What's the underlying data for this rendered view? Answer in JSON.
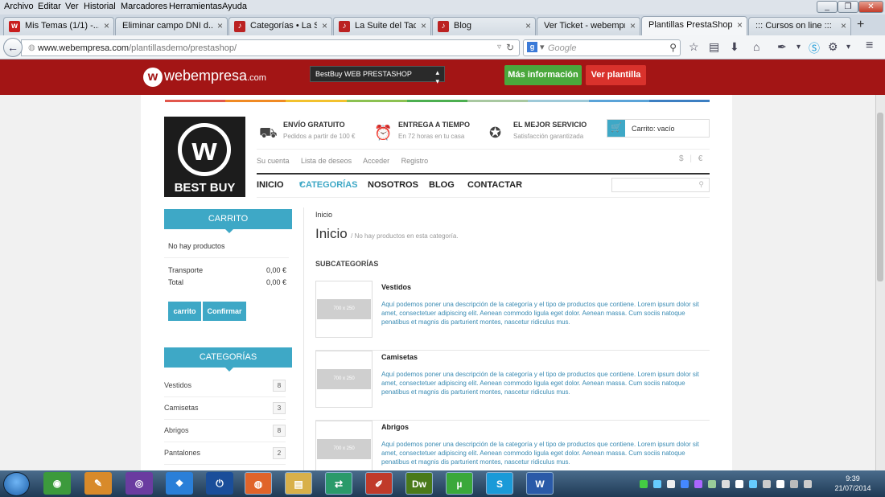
{
  "menu": [
    "Archivo",
    "Editar",
    "Ver",
    "Historial",
    "Marcadores",
    "Herramientas",
    "Ayuda"
  ],
  "tabs": [
    {
      "title": "Mis Temas (1/1) -...",
      "color": "#c81e1e",
      "glyph": "w"
    },
    {
      "title": "Eliminar campo DNI d...",
      "color": "",
      "glyph": ""
    },
    {
      "title": "Categorías • La Su...",
      "color": "#b22",
      "glyph": "♪"
    },
    {
      "title": "La Suite del Tacón",
      "color": "#b22",
      "glyph": "♪"
    },
    {
      "title": "Blog",
      "color": "#b22",
      "glyph": "♪"
    },
    {
      "title": "Ver Ticket - webempr...",
      "color": "",
      "glyph": ""
    },
    {
      "title": "Plantillas PrestaShop -...",
      "color": "",
      "glyph": ""
    },
    {
      "title": "::: Cursos on line :::",
      "color": "",
      "glyph": ""
    }
  ],
  "url": {
    "host": "www.webempresa.com",
    "path": "/plantillasdemo/prestashop/"
  },
  "search_placeholder": "Google",
  "demobar": {
    "logo_main": "webempresa",
    "logo_suffix": ".com",
    "theme_selected": "BestBuy WEB PRESTASHOP",
    "btn_info": "Más información",
    "btn_ver": "Ver plantilla"
  },
  "colors": {
    "accent": "#3ea8c6",
    "brand_red": "#a31515",
    "green": "#4aa83c"
  },
  "strip_colors": [
    "#e2574c",
    "#f08a24",
    "#f2c12e",
    "#8cc152",
    "#4caf50",
    "#a8c8a0",
    "#9ec9d8",
    "#5aa3d8",
    "#3c7fc2"
  ],
  "shop": {
    "logo_text": "BEST BUY",
    "features": [
      {
        "title": "ENVÍO GRATUITO",
        "sub": "Pedidos a partir de 100 €",
        "icon": "truck-icon"
      },
      {
        "title": "ENTREGA A TIEMPO",
        "sub": "En 72 horas en tu casa",
        "icon": "alarm-clock-icon"
      },
      {
        "title": "EL MEJOR SERVICIO",
        "sub": "Satisfacción garantizada",
        "icon": "medal-icon"
      }
    ],
    "cart_label": "Carrito: vacío",
    "toplinks": [
      "Su cuenta",
      "Lista de deseos",
      "Acceder",
      "Registro"
    ],
    "currencies": [
      "$",
      "€"
    ],
    "nav": [
      "INICIO",
      "CATEGORÍAS",
      "NOSOTROS",
      "BLOG",
      "CONTACTAR"
    ]
  },
  "cart": {
    "heading": "CARRITO",
    "empty": "No hay productos",
    "shipping_label": "Transporte",
    "shipping_value": "0,00 €",
    "total_label": "Total",
    "total_value": "0,00 €",
    "btn_cart": "carrito",
    "btn_confirm": "Confirmar"
  },
  "categories": {
    "heading": "CATEGORÍAS",
    "items": [
      {
        "name": "Vestidos",
        "count": "8"
      },
      {
        "name": "Camisetas",
        "count": "3"
      },
      {
        "name": "Abrigos",
        "count": "8"
      },
      {
        "name": "Pantalones",
        "count": "2"
      }
    ]
  },
  "main": {
    "breadcrumb": "Inicio",
    "title": "Inicio",
    "subtitle": "/ No hay productos en esta categoría.",
    "subcats_heading": "SUBCATEGORÍAS",
    "placeholder": "700 x 250",
    "subcats": [
      {
        "name": "Vestidos",
        "desc": "Aquí podemos poner una descripción de la categoría y el tipo de productos que contiene. Lorem ipsum dolor sit amet, consectetuer adipiscing elit. Aenean commodo ligula eget dolor. Aenean massa. Cum sociis natoque penatibus et magnis dis parturient montes, nascetur ridiculus mus."
      },
      {
        "name": "Camisetas",
        "desc": "Aquí podemos poner una descripción de la categoría y el tipo de productos que contiene. Lorem ipsum dolor sit amet, consectetuer adipiscing elit. Aenean commodo ligula eget dolor. Aenean massa. Cum sociis natoque penatibus et magnis dis parturient montes, nascetur ridiculus mus."
      },
      {
        "name": "Abrigos",
        "desc": "Aquí podemos poner una descripción de la categoría y el tipo de productos que contiene. Lorem ipsum dolor sit amet, consectetuer adipiscing elit. Aenean commodo ligula eget dolor. Aenean massa. Cum sociis natoque penatibus et magnis dis parturient montes, nascetur ridiculus mus."
      }
    ]
  },
  "taskbar": {
    "apps": [
      {
        "name": "chrome-icon",
        "bg": "#3c9a3c",
        "glyph": "◉"
      },
      {
        "name": "paint-icon",
        "bg": "#d88a2a",
        "glyph": "✎"
      },
      {
        "name": "media-icon",
        "bg": "#6a3ca0",
        "glyph": "◎"
      },
      {
        "name": "dropbox-icon",
        "bg": "#2a7fd8",
        "glyph": "❖"
      },
      {
        "name": "power-icon",
        "bg": "#1a4e9a",
        "glyph": "⏻"
      },
      {
        "name": "firefox-icon",
        "bg": "#e0642a",
        "glyph": "◍"
      },
      {
        "name": "explorer-icon",
        "bg": "#d8b04a",
        "glyph": "▤"
      },
      {
        "name": "sync-icon",
        "bg": "#2a9a6a",
        "glyph": "⇄"
      },
      {
        "name": "brush-icon",
        "bg": "#c03a2a",
        "glyph": "✐"
      },
      {
        "name": "dreamweaver-icon",
        "bg": "#4a7a1a",
        "glyph": "Dw"
      },
      {
        "name": "utorrent-icon",
        "bg": "#3aa83a",
        "glyph": "µ"
      },
      {
        "name": "skype-icon",
        "bg": "#1a9ad8",
        "glyph": "S"
      },
      {
        "name": "word-icon",
        "bg": "#2a5aa8",
        "glyph": "W"
      }
    ],
    "time": "9:39",
    "date": "21/07/2014"
  }
}
